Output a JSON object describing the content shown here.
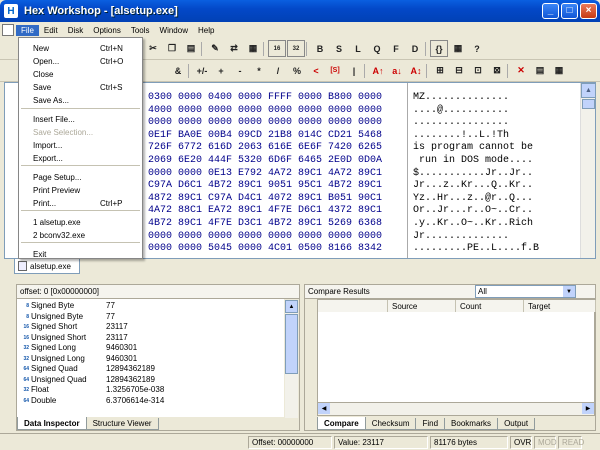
{
  "window": {
    "title": "Hex Workshop - [alsetup.exe]"
  },
  "menu": [
    "File",
    "Edit",
    "Disk",
    "Options",
    "Tools",
    "Window",
    "Help"
  ],
  "toolbar1": [
    "B",
    "S",
    "L",
    "Q",
    "F",
    "D"
  ],
  "toolbar2": [
    "&",
    "+/-",
    "+",
    "-",
    "*",
    "/",
    "%",
    "<",
    "[S]",
    "|"
  ],
  "file_menu": [
    {
      "label": "New",
      "shortcut": "Ctrl+N"
    },
    {
      "label": "Open...",
      "shortcut": "Ctrl+O"
    },
    {
      "label": "Close",
      "shortcut": ""
    },
    {
      "label": "Save",
      "shortcut": "Ctrl+S"
    },
    {
      "label": "Save As...",
      "shortcut": ""
    },
    {
      "label": "Insert File...",
      "shortcut": ""
    },
    {
      "label": "Save Selection...",
      "shortcut": "",
      "disabled": true
    },
    {
      "label": "Import...",
      "shortcut": ""
    },
    {
      "label": "Export...",
      "shortcut": ""
    },
    {
      "label": "Page Setup...",
      "shortcut": ""
    },
    {
      "label": "Print Preview",
      "shortcut": ""
    },
    {
      "label": "Print...",
      "shortcut": "Ctrl+P"
    },
    {
      "label": "1 alsetup.exe",
      "shortcut": ""
    },
    {
      "label": "2 bconv32.exe",
      "shortcut": ""
    },
    {
      "label": "Exit",
      "shortcut": ""
    }
  ],
  "hex_rows": [
    "0300 0000 0400 0000 FFFF 0000 B800 0000",
    "4000 0000 0000 0000 0000 0000 0000 0000",
    "0000 0000 0000 0000 0000 0000 0000 0000",
    "0E1F BA0E 00B4 09CD 21B8 014C CD21 5468",
    "726F 6772 616D 2063 616E 6E6F 7420 6265",
    "2069 6E20 444F 5320 6D6F 6465 2E0D 0D0A",
    "0000 0000 0E13 E792 4A72 89C1 4A72 89C1",
    "C97A D6C1 4B72 89C1 9051 95C1 4B72 89C1",
    "4872 89C1 C97A D4C1 4072 89C1 B051 90C1",
    "4A72 88C1 EA72 89C1 4F7E D6C1 4372 89C1",
    "4B72 89C1 4F7E D3C1 4B72 89C1 5269 6368",
    "0000 0000 0000 0000 0000 0000 0000 0000",
    "0000 0000 5045 0000 4C01 0500 8166 8342"
  ],
  "ascii_rows": [
    "MZ..............",
    "....@...........",
    "................",
    "........!..L.!Th",
    "is program cannot be",
    " run in DOS mode....",
    "$...........Jr..Jr..",
    "Jr...z..Kr...Q..Kr..",
    "Yz..Hr...z..@r..Q...",
    "Or..Jr...r..O~..Cr..",
    ".y..Kr..O~..Kr..Rich",
    "Jr..............",
    ".........PE..L....f.B"
  ],
  "doc_tab": "alsetup.exe",
  "inspector": {
    "offset_label": "offset: 0 [0x00000000]",
    "rows": [
      {
        "bits": "8",
        "name": "Signed Byte",
        "value": "77"
      },
      {
        "bits": "8",
        "name": "Unsigned Byte",
        "value": "77"
      },
      {
        "bits": "16",
        "name": "Signed Short",
        "value": "23117"
      },
      {
        "bits": "16",
        "name": "Unsigned Short",
        "value": "23117"
      },
      {
        "bits": "32",
        "name": "Signed Long",
        "value": "9460301"
      },
      {
        "bits": "32",
        "name": "Unsigned Long",
        "value": "9460301"
      },
      {
        "bits": "64",
        "name": "Signed Quad",
        "value": "12894362189"
      },
      {
        "bits": "64",
        "name": "Unsigned Quad",
        "value": "12894362189"
      },
      {
        "bits": "32",
        "name": "Float",
        "value": "1.3256705e-038"
      },
      {
        "bits": "64",
        "name": "Double",
        "value": "6.3706614e-314"
      }
    ],
    "tabs": [
      "Data Inspector",
      "Structure Viewer"
    ]
  },
  "compare": {
    "title": "Compare Results",
    "filter": "All",
    "columns": [
      "Source",
      "Count",
      "Target"
    ],
    "tabs": [
      "Compare",
      "Checksum",
      "Find",
      "Bookmarks",
      "Output"
    ]
  },
  "status": {
    "offset": "Offset: 00000000",
    "value": "Value: 23117",
    "size": "81176 bytes",
    "ovr": "OVR",
    "mod": "MOD",
    "read": "READ"
  }
}
